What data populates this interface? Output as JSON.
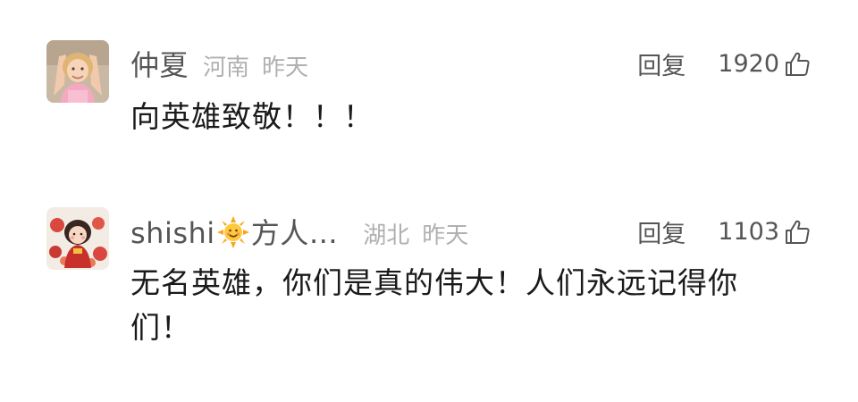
{
  "comments": [
    {
      "username": "仲夏",
      "location": "河南",
      "time": "昨天",
      "reply_label": "回复",
      "likes": "1920",
      "text": "向英雄致敬！！！",
      "avatar_icon": "child-photo-avatar-icon",
      "like_icon": "thumbs-up-outline-icon"
    },
    {
      "username_prefix": "shishi",
      "username_emoji": "sun-face-emoji-icon",
      "username_suffix": "方人…",
      "location": "湖北",
      "time": "昨天",
      "reply_label": "回复",
      "likes": "1103",
      "text": "无名英雄，你们是真的伟大！人们永远记得你们！",
      "avatar_icon": "illustrated-girl-avatar-icon",
      "like_icon": "thumbs-up-outline-icon"
    }
  ],
  "colors": {
    "username": "#555555",
    "meta": "#b0b0b0",
    "body": "#1a1a1a",
    "background": "#ffffff"
  }
}
